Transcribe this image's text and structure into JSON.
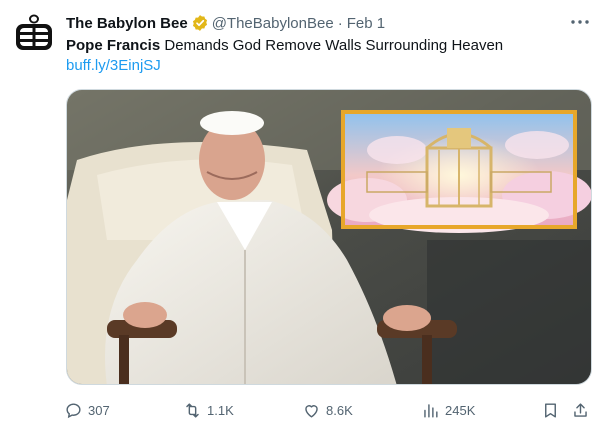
{
  "author": {
    "display_name": "The Babylon Bee",
    "handle": "@TheBabylonBee",
    "separator": "·",
    "date": "Feb 1",
    "avatar_icon": "babylon-bee-logo",
    "verified_color": "#e2b719"
  },
  "tweet": {
    "headline_bold": "Pope Francis",
    "headline_rest": " Demands God Remove Walls Surrounding Heaven",
    "link_text": "buff.ly/3EinjSJ"
  },
  "media": {
    "description_icon": "pope-photo-with-heaven-gates-inset",
    "inset_border_color": "#e7a72a"
  },
  "actions": {
    "reply_count": "307",
    "retweet_count": "1.1K",
    "like_count": "8.6K",
    "views_count": "245K"
  },
  "colors": {
    "text": "#0f1419",
    "secondary": "#536471",
    "link": "#1d9bf0"
  }
}
